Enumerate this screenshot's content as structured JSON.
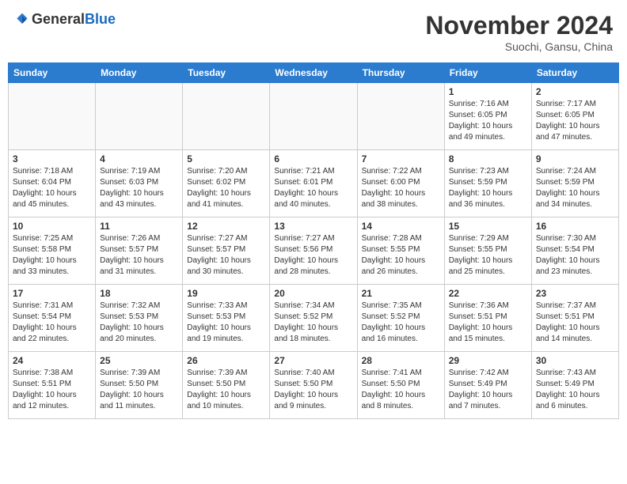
{
  "header": {
    "logo_general": "General",
    "logo_blue": "Blue",
    "month_title": "November 2024",
    "location": "Suochi, Gansu, China"
  },
  "days_of_week": [
    "Sunday",
    "Monday",
    "Tuesday",
    "Wednesday",
    "Thursday",
    "Friday",
    "Saturday"
  ],
  "weeks": [
    [
      {
        "day": "",
        "info": ""
      },
      {
        "day": "",
        "info": ""
      },
      {
        "day": "",
        "info": ""
      },
      {
        "day": "",
        "info": ""
      },
      {
        "day": "",
        "info": ""
      },
      {
        "day": "1",
        "info": "Sunrise: 7:16 AM\nSunset: 6:05 PM\nDaylight: 10 hours\nand 49 minutes."
      },
      {
        "day": "2",
        "info": "Sunrise: 7:17 AM\nSunset: 6:05 PM\nDaylight: 10 hours\nand 47 minutes."
      }
    ],
    [
      {
        "day": "3",
        "info": "Sunrise: 7:18 AM\nSunset: 6:04 PM\nDaylight: 10 hours\nand 45 minutes."
      },
      {
        "day": "4",
        "info": "Sunrise: 7:19 AM\nSunset: 6:03 PM\nDaylight: 10 hours\nand 43 minutes."
      },
      {
        "day": "5",
        "info": "Sunrise: 7:20 AM\nSunset: 6:02 PM\nDaylight: 10 hours\nand 41 minutes."
      },
      {
        "day": "6",
        "info": "Sunrise: 7:21 AM\nSunset: 6:01 PM\nDaylight: 10 hours\nand 40 minutes."
      },
      {
        "day": "7",
        "info": "Sunrise: 7:22 AM\nSunset: 6:00 PM\nDaylight: 10 hours\nand 38 minutes."
      },
      {
        "day": "8",
        "info": "Sunrise: 7:23 AM\nSunset: 5:59 PM\nDaylight: 10 hours\nand 36 minutes."
      },
      {
        "day": "9",
        "info": "Sunrise: 7:24 AM\nSunset: 5:59 PM\nDaylight: 10 hours\nand 34 minutes."
      }
    ],
    [
      {
        "day": "10",
        "info": "Sunrise: 7:25 AM\nSunset: 5:58 PM\nDaylight: 10 hours\nand 33 minutes."
      },
      {
        "day": "11",
        "info": "Sunrise: 7:26 AM\nSunset: 5:57 PM\nDaylight: 10 hours\nand 31 minutes."
      },
      {
        "day": "12",
        "info": "Sunrise: 7:27 AM\nSunset: 5:57 PM\nDaylight: 10 hours\nand 30 minutes."
      },
      {
        "day": "13",
        "info": "Sunrise: 7:27 AM\nSunset: 5:56 PM\nDaylight: 10 hours\nand 28 minutes."
      },
      {
        "day": "14",
        "info": "Sunrise: 7:28 AM\nSunset: 5:55 PM\nDaylight: 10 hours\nand 26 minutes."
      },
      {
        "day": "15",
        "info": "Sunrise: 7:29 AM\nSunset: 5:55 PM\nDaylight: 10 hours\nand 25 minutes."
      },
      {
        "day": "16",
        "info": "Sunrise: 7:30 AM\nSunset: 5:54 PM\nDaylight: 10 hours\nand 23 minutes."
      }
    ],
    [
      {
        "day": "17",
        "info": "Sunrise: 7:31 AM\nSunset: 5:54 PM\nDaylight: 10 hours\nand 22 minutes."
      },
      {
        "day": "18",
        "info": "Sunrise: 7:32 AM\nSunset: 5:53 PM\nDaylight: 10 hours\nand 20 minutes."
      },
      {
        "day": "19",
        "info": "Sunrise: 7:33 AM\nSunset: 5:53 PM\nDaylight: 10 hours\nand 19 minutes."
      },
      {
        "day": "20",
        "info": "Sunrise: 7:34 AM\nSunset: 5:52 PM\nDaylight: 10 hours\nand 18 minutes."
      },
      {
        "day": "21",
        "info": "Sunrise: 7:35 AM\nSunset: 5:52 PM\nDaylight: 10 hours\nand 16 minutes."
      },
      {
        "day": "22",
        "info": "Sunrise: 7:36 AM\nSunset: 5:51 PM\nDaylight: 10 hours\nand 15 minutes."
      },
      {
        "day": "23",
        "info": "Sunrise: 7:37 AM\nSunset: 5:51 PM\nDaylight: 10 hours\nand 14 minutes."
      }
    ],
    [
      {
        "day": "24",
        "info": "Sunrise: 7:38 AM\nSunset: 5:51 PM\nDaylight: 10 hours\nand 12 minutes."
      },
      {
        "day": "25",
        "info": "Sunrise: 7:39 AM\nSunset: 5:50 PM\nDaylight: 10 hours\nand 11 minutes."
      },
      {
        "day": "26",
        "info": "Sunrise: 7:39 AM\nSunset: 5:50 PM\nDaylight: 10 hours\nand 10 minutes."
      },
      {
        "day": "27",
        "info": "Sunrise: 7:40 AM\nSunset: 5:50 PM\nDaylight: 10 hours\nand 9 minutes."
      },
      {
        "day": "28",
        "info": "Sunrise: 7:41 AM\nSunset: 5:50 PM\nDaylight: 10 hours\nand 8 minutes."
      },
      {
        "day": "29",
        "info": "Sunrise: 7:42 AM\nSunset: 5:49 PM\nDaylight: 10 hours\nand 7 minutes."
      },
      {
        "day": "30",
        "info": "Sunrise: 7:43 AM\nSunset: 5:49 PM\nDaylight: 10 hours\nand 6 minutes."
      }
    ]
  ]
}
